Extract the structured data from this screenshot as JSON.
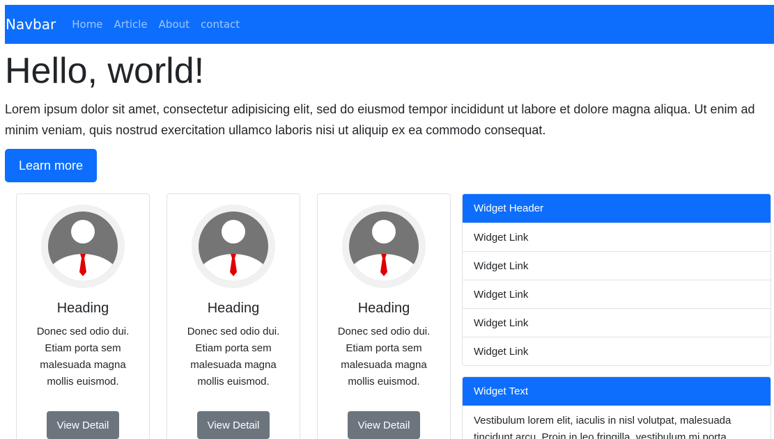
{
  "navbar": {
    "brand": "Navbar",
    "links": [
      "Home",
      "Article",
      "About",
      "contact"
    ]
  },
  "hero": {
    "title": "Hello, world!",
    "lead": "Lorem ipsum dolor sit amet, consectetur adipisicing elit, sed do eiusmod tempor incididunt ut labore et dolore magna aliqua. Ut enim ad minim veniam, quis nostrud exercitation ullamco laboris nisi ut aliquip ex ea commodo consequat.",
    "button": "Learn more"
  },
  "cards": [
    {
      "heading": "Heading",
      "text": "Donec sed odio dui. Etiam porta sem malesuada magna mollis euismod.",
      "button": "View Detail"
    },
    {
      "heading": "Heading",
      "text": "Donec sed odio dui. Etiam porta sem malesuada magna mollis euismod.",
      "button": "View Detail"
    },
    {
      "heading": "Heading",
      "text": "Donec sed odio dui. Etiam porta sem malesuada magna mollis euismod.",
      "button": "View Detail"
    }
  ],
  "widget_links": {
    "header": "Widget Header",
    "links": [
      "Widget Link",
      "Widget Link",
      "Widget Link",
      "Widget Link",
      "Widget Link"
    ]
  },
  "widget_text": {
    "header": "Widget Text",
    "body": "Vestibulum lorem elit, iaculis in nisl volutpat, malesuada tincidunt arcu. Proin in leo fringilla, vestibulum mi porta,"
  },
  "colors": {
    "primary": "#0d6efd",
    "secondary": "#6c757d",
    "avatar_gray": "#757575",
    "tie_red": "#e00000"
  }
}
